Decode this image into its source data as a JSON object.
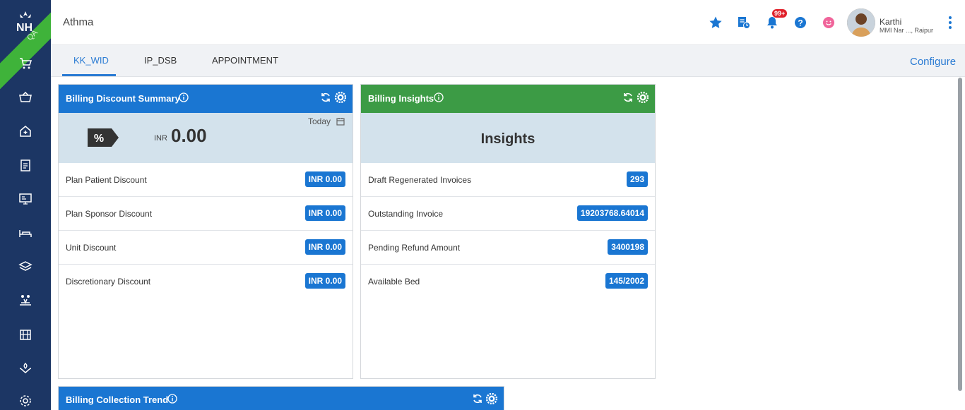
{
  "app": {
    "title": "Athma",
    "env_badge": "QA"
  },
  "header": {
    "notification_count": "99+",
    "user": {
      "name": "Karthi",
      "location": "MMI Nar ..., Raipur"
    }
  },
  "tabs": [
    {
      "label": "KK_WID"
    },
    {
      "label": "IP_DSB"
    },
    {
      "label": "APPOINTMENT"
    }
  ],
  "configure_label": "Configure",
  "billing_discount": {
    "title": "Billing Discount Summary",
    "period": "Today",
    "currency": "INR",
    "total": "0.00",
    "rows": [
      {
        "label": "Plan Patient Discount",
        "value": "INR 0.00"
      },
      {
        "label": "Plan Sponsor Discount",
        "value": "INR 0.00"
      },
      {
        "label": "Unit Discount",
        "value": "INR 0.00"
      },
      {
        "label": "Discretionary Discount",
        "value": "INR 0.00"
      }
    ]
  },
  "billing_insights": {
    "title": "Billing Insights",
    "heading": "Insights",
    "rows": [
      {
        "label": "Draft Regenerated Invoices",
        "value": "293"
      },
      {
        "label": "Outstanding Invoice",
        "value": "19203768.64014"
      },
      {
        "label": "Pending Refund Amount",
        "value": "3400198"
      },
      {
        "label": "Available Bed",
        "value": "145/2002"
      }
    ]
  },
  "billing_collection": {
    "title": "Billing Collection Trend"
  },
  "colors": {
    "sidebar": "#1c3664",
    "blue_header": "#1a76d2",
    "green_header": "#3c9b45",
    "accent": "#2a7bd3"
  }
}
